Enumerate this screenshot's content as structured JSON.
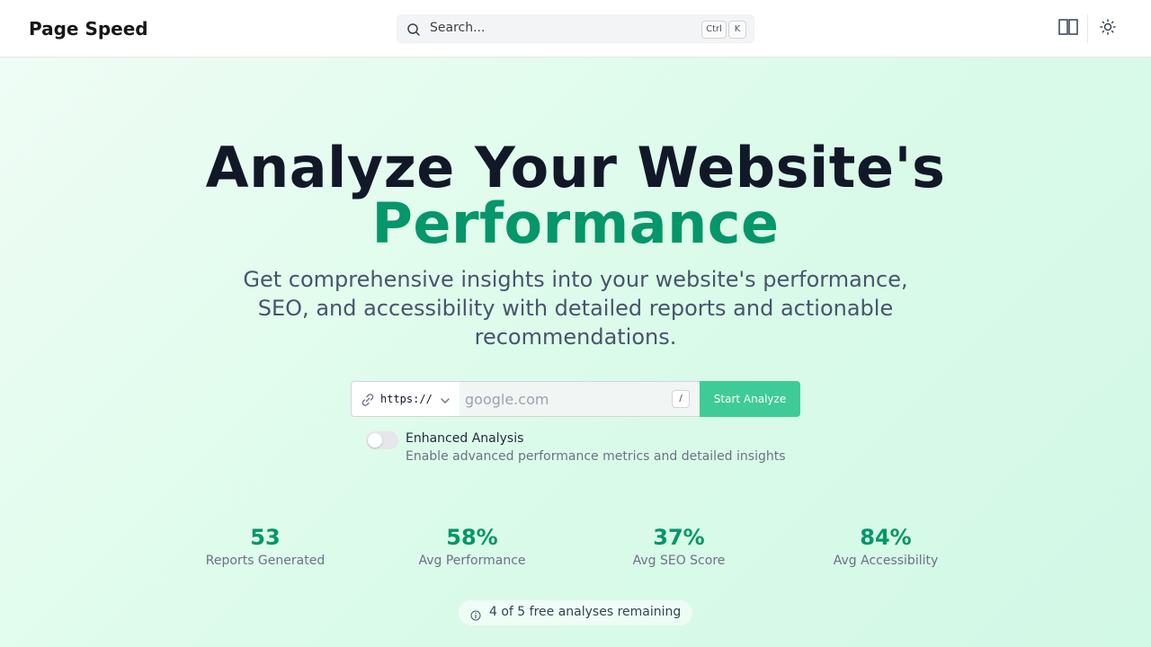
{
  "header": {
    "brand": "Page Speed",
    "search_placeholder": "Search...",
    "kbd_ctrl": "Ctrl",
    "kbd_k": "K"
  },
  "hero": {
    "title_line1": "Analyze Your Website's",
    "title_line2": "Performance",
    "subtitle": "Get comprehensive insights into your website's performance, SEO, and accessibility with detailed reports and actionable recommendations."
  },
  "form": {
    "protocol": "https://",
    "url_placeholder": "google.com",
    "shortcut": "/",
    "submit_label": "Start Analyze"
  },
  "enhanced": {
    "label": "Enhanced Analysis",
    "description": "Enable advanced performance metrics and detailed insights",
    "enabled": false
  },
  "stats": [
    {
      "value": "53",
      "label": "Reports Generated"
    },
    {
      "value": "58%",
      "label": "Avg Performance"
    },
    {
      "value": "37%",
      "label": "Avg SEO Score"
    },
    {
      "value": "84%",
      "label": "Avg Accessibility"
    }
  ],
  "quota": {
    "text": "4 of 5 free analyses remaining"
  },
  "colors": {
    "accent": "#059669",
    "button": "#3ecb97",
    "title": "#111827"
  },
  "icons": [
    "search-icon",
    "layout-icon",
    "sun-icon",
    "link-icon",
    "chevron-down-icon",
    "info-icon"
  ]
}
